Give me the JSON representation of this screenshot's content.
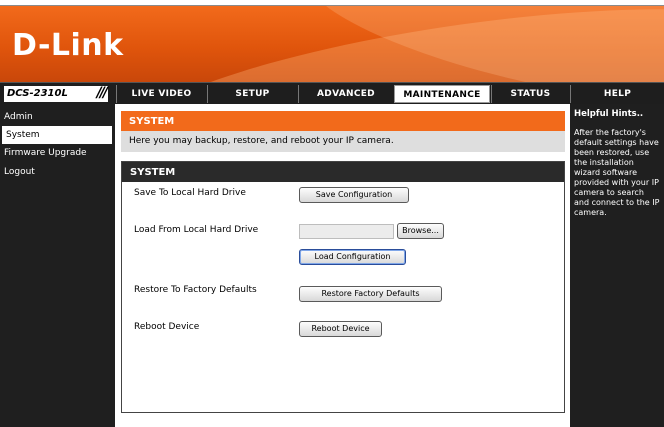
{
  "brand": {
    "logo_text": "D-Link"
  },
  "nav": {
    "model": "DCS-2310L",
    "slashes": "///",
    "tabs": [
      {
        "label": "LIVE VIDEO"
      },
      {
        "label": "SETUP"
      },
      {
        "label": "ADVANCED"
      },
      {
        "label": "MAINTENANCE",
        "active": true
      },
      {
        "label": "STATUS"
      },
      {
        "label": "HELP"
      }
    ]
  },
  "sidebar": {
    "items": [
      {
        "label": "Admin"
      },
      {
        "label": "System",
        "active": true
      },
      {
        "label": "Firmware Upgrade"
      },
      {
        "label": "Logout"
      }
    ]
  },
  "main": {
    "title": "SYSTEM",
    "description": "Here you may backup, restore, and reboot your IP camera.",
    "panel_title": "SYSTEM",
    "save_label": "Save To Local Hard Drive",
    "save_button": "Save Configuration",
    "load_label": "Load From Local Hard Drive",
    "browse_button": "Browse...",
    "load_button": "Load Configuration",
    "restore_label": "Restore To Factory Defaults",
    "restore_button": "Restore Factory Defaults",
    "reboot_label": "Reboot Device",
    "reboot_button": "Reboot Device"
  },
  "hints": {
    "title": "Helpful Hints..",
    "body": "After the factory's default settings have been restored, use the installation wizard software provided with your IP camera to search and connect to the IP camera."
  },
  "colors": {
    "accent": "#f26a1b",
    "dark": "#1f1f1f",
    "description_bg": "#dedede"
  }
}
